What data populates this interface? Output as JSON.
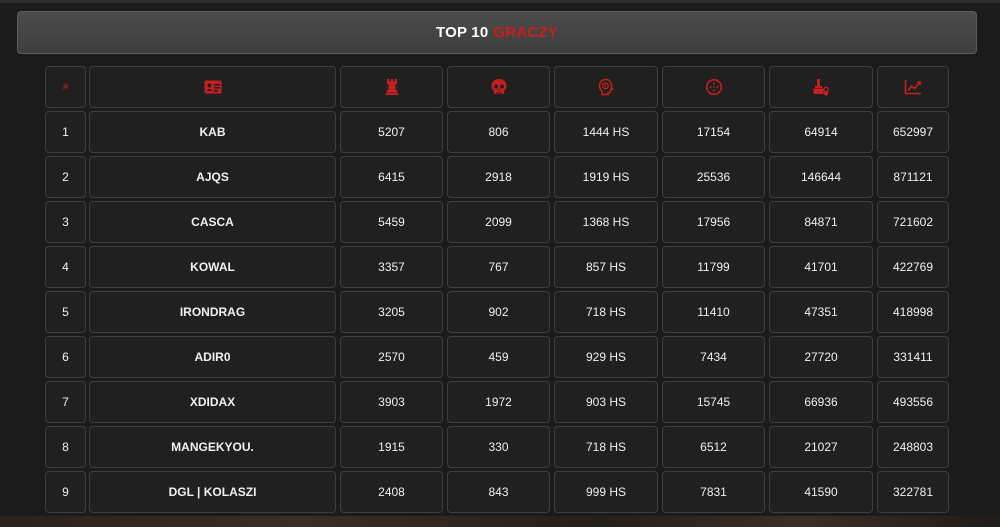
{
  "header": {
    "title_a": "TOP 10",
    "title_b": "GRACZY",
    "accent": "#c81e1e"
  },
  "table": {
    "columns": [
      {
        "key": "rank",
        "label": "#",
        "icon": "hash"
      },
      {
        "key": "name",
        "icon": "id-card-icon"
      },
      {
        "key": "kills",
        "icon": "chess-rook-icon"
      },
      {
        "key": "deaths",
        "icon": "skull-icon"
      },
      {
        "key": "hs",
        "icon": "head-target-icon"
      },
      {
        "key": "shots",
        "icon": "crosshair-icon"
      },
      {
        "key": "hits",
        "icon": "medal-stack-icon"
      },
      {
        "key": "damage",
        "icon": "chart-line-icon"
      }
    ],
    "rows": [
      {
        "rank": "1",
        "name": "KAB",
        "kills": "5207",
        "deaths": "806",
        "hs": "1444 HS",
        "shots": "17154",
        "hits": "64914",
        "damage": "652997"
      },
      {
        "rank": "2",
        "name": "AJQS",
        "kills": "6415",
        "deaths": "2918",
        "hs": "1919 HS",
        "shots": "25536",
        "hits": "146644",
        "damage": "871121"
      },
      {
        "rank": "3",
        "name": "CASCA",
        "kills": "5459",
        "deaths": "2099",
        "hs": "1368 HS",
        "shots": "17956",
        "hits": "84871",
        "damage": "721602"
      },
      {
        "rank": "4",
        "name": "KOWAL",
        "kills": "3357",
        "deaths": "767",
        "hs": "857 HS",
        "shots": "11799",
        "hits": "41701",
        "damage": "422769"
      },
      {
        "rank": "5",
        "name": "IRONDRAG",
        "kills": "3205",
        "deaths": "902",
        "hs": "718 HS",
        "shots": "11410",
        "hits": "47351",
        "damage": "418998"
      },
      {
        "rank": "6",
        "name": "ADIR0",
        "kills": "2570",
        "deaths": "459",
        "hs": "929 HS",
        "shots": "7434",
        "hits": "27720",
        "damage": "331411"
      },
      {
        "rank": "7",
        "name": "XDIDAX",
        "kills": "3903",
        "deaths": "1972",
        "hs": "903 HS",
        "shots": "15745",
        "hits": "66936",
        "damage": "493556"
      },
      {
        "rank": "8",
        "name": "MANGEKYOU.",
        "kills": "1915",
        "deaths": "330",
        "hs": "718 HS",
        "shots": "6512",
        "hits": "21027",
        "damage": "248803"
      },
      {
        "rank": "9",
        "name": "DGL | KOLASZI",
        "kills": "2408",
        "deaths": "843",
        "hs": "999 HS",
        "shots": "7831",
        "hits": "41590",
        "damage": "322781"
      }
    ]
  }
}
